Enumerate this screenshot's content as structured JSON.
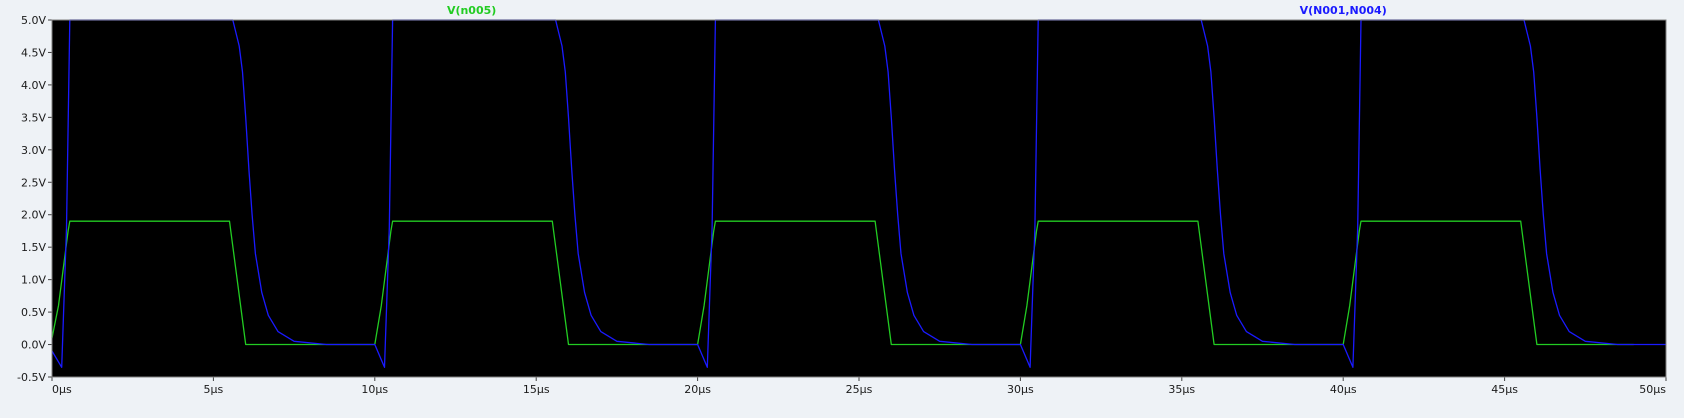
{
  "chart_data": {
    "type": "line",
    "title": "",
    "xlabel": "",
    "ylabel": "",
    "xlim": [
      0,
      50
    ],
    "ylim": [
      -0.5,
      5.0
    ],
    "x_unit": "µs",
    "y_unit": "V",
    "x_ticks": [
      0,
      5,
      10,
      15,
      20,
      25,
      30,
      35,
      40,
      45,
      50
    ],
    "x_tick_labels": [
      "0µs",
      "5µs",
      "10µs",
      "15µs",
      "20µs",
      "25µs",
      "30µs",
      "35µs",
      "40µs",
      "45µs",
      "50µs"
    ],
    "y_ticks": [
      -0.5,
      0.0,
      0.5,
      1.0,
      1.5,
      2.0,
      2.5,
      3.0,
      3.5,
      4.0,
      4.5,
      5.0
    ],
    "y_tick_labels": [
      "-0.5V",
      "0.0V",
      "0.5V",
      "1.0V",
      "1.5V",
      "2.0V",
      "2.5V",
      "3.0V",
      "3.5V",
      "4.0V",
      "4.5V",
      "5.0V"
    ],
    "grid": false,
    "background": "#000000",
    "series": [
      {
        "name": "V(n005)",
        "color": "#22cc22",
        "x": [
          0,
          0.2,
          0.5,
          0.55,
          5.5,
          6.0,
          10.0,
          10.2,
          10.5,
          10.55,
          15.5,
          16.0,
          20.0,
          20.2,
          20.5,
          20.55,
          25.5,
          26.0,
          30.0,
          30.2,
          30.5,
          30.55,
          35.5,
          36.0,
          40.0,
          40.2,
          40.5,
          40.55,
          45.5,
          46.0,
          49.0
        ],
        "y": [
          0.1,
          0.6,
          1.75,
          1.9,
          1.9,
          0.0,
          0.0,
          0.6,
          1.75,
          1.9,
          1.9,
          0.0,
          0.0,
          0.6,
          1.75,
          1.9,
          1.9,
          0.0,
          0.0,
          0.6,
          1.75,
          1.9,
          1.9,
          0.0,
          0.0,
          0.6,
          1.75,
          1.9,
          1.9,
          0.0,
          0.0
        ]
      },
      {
        "name": "V(N001,N004)",
        "color": "#1a1aff",
        "x": [
          0,
          0.3,
          0.45,
          0.55,
          5.6,
          5.8,
          5.9,
          6.0,
          6.1,
          6.2,
          6.3,
          6.5,
          6.7,
          7.0,
          7.5,
          8.5,
          10.0,
          10.3,
          10.45,
          10.55,
          15.6,
          15.8,
          15.9,
          16.0,
          16.1,
          16.2,
          16.3,
          16.5,
          16.7,
          17.0,
          17.5,
          18.5,
          20.0,
          20.3,
          20.45,
          20.55,
          25.6,
          25.8,
          25.9,
          26.0,
          26.1,
          26.2,
          26.3,
          26.5,
          26.7,
          27.0,
          27.5,
          28.5,
          30.0,
          30.3,
          30.45,
          30.55,
          35.6,
          35.8,
          35.9,
          36.0,
          36.1,
          36.2,
          36.3,
          36.5,
          36.7,
          37.0,
          37.5,
          38.5,
          40.0,
          40.3,
          40.45,
          40.55,
          45.6,
          45.8,
          45.9,
          46.0,
          46.1,
          46.2,
          46.3,
          46.5,
          46.7,
          47.0,
          47.5,
          48.5,
          50.0
        ],
        "y": [
          -0.1,
          -0.35,
          1.8,
          5.0,
          5.0,
          4.6,
          4.2,
          3.5,
          2.7,
          2.0,
          1.4,
          0.8,
          0.45,
          0.2,
          0.05,
          0.0,
          0.0,
          -0.35,
          1.8,
          5.0,
          5.0,
          4.6,
          4.2,
          3.5,
          2.7,
          2.0,
          1.4,
          0.8,
          0.45,
          0.2,
          0.05,
          0.0,
          0.0,
          -0.35,
          1.8,
          5.0,
          5.0,
          4.6,
          4.2,
          3.5,
          2.7,
          2.0,
          1.4,
          0.8,
          0.45,
          0.2,
          0.05,
          0.0,
          0.0,
          -0.35,
          1.8,
          5.0,
          5.0,
          4.6,
          4.2,
          3.5,
          2.7,
          2.0,
          1.4,
          0.8,
          0.45,
          0.2,
          0.05,
          0.0,
          0.0,
          -0.35,
          1.8,
          5.0,
          5.0,
          4.6,
          4.2,
          3.5,
          2.7,
          2.0,
          1.4,
          0.8,
          0.45,
          0.2,
          0.05,
          0.0,
          0.0
        ]
      }
    ]
  }
}
